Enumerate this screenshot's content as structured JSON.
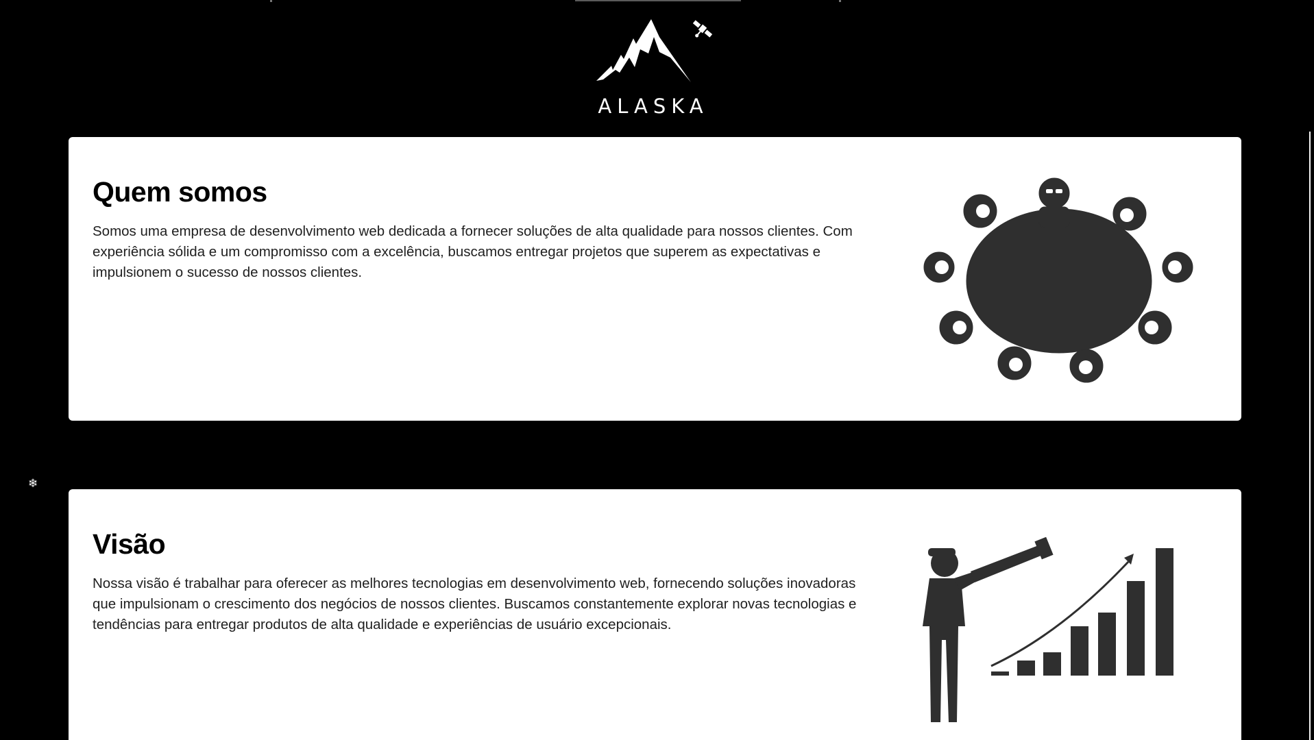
{
  "brand": {
    "name": "ALASKA",
    "logo_icon": "mountain-satellite-logo"
  },
  "sections": {
    "about": {
      "title": "Quem somos",
      "text": "Somos uma empresa de desenvolvimento web dedicada a fornecer soluções de alta qualidade para nossos clientes. Com experiência sólida e um compromisso com a excelência, buscamos entregar projetos que superem as expectativas e impulsionem o sucesso de nossos clientes.",
      "illustration_icon": "team-round-table-icon"
    },
    "vision": {
      "title": "Visão",
      "text": "Nossa visão é trabalhar para oferecer as melhores tecnologias em desenvolvimento web, fornecendo soluções inovadoras que impulsionam o crescimento dos negócios de nossos clientes. Buscamos constantemente explorar novas tecnologias e tendências para entregar produtos de alta qualidade e experiências de usuário excepcionais.",
      "illustration_icon": "telescope-growth-chart-icon"
    }
  },
  "decor": {
    "snowflake": "❄",
    "snowflake_icon": "snowflake-icon"
  },
  "colors": {
    "background": "#000000",
    "card": "#ffffff",
    "illustration": "#2f2f2f",
    "text": "#1f1f1f"
  }
}
